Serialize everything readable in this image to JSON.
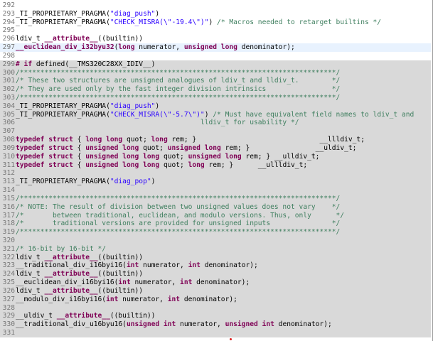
{
  "editor": {
    "lines": [
      {
        "num": "292",
        "tokens": []
      },
      {
        "num": "293",
        "tokens": [
          {
            "t": "_TI_PROPRIETARY_PRAGMA("
          },
          {
            "t": "\"diag_push\"",
            "c": "st"
          },
          {
            "t": ")"
          }
        ]
      },
      {
        "num": "294",
        "tokens": [
          {
            "t": "_TI_PROPRIETARY_PRAGMA("
          },
          {
            "t": "\"CHECK_MISRA(\\\"-19.4\\\")\"",
            "c": "st"
          },
          {
            "t": ") "
          },
          {
            "t": "/* Macros needed to retarget builtins */",
            "c": "cm"
          }
        ]
      },
      {
        "num": "295",
        "tokens": []
      },
      {
        "num": "296",
        "tokens": [
          {
            "t": "ldiv_t "
          },
          {
            "t": "__attribute__",
            "c": "kw"
          },
          {
            "t": "((builtin))"
          }
        ]
      },
      {
        "num": "297",
        "cursor": true,
        "tokens": [
          {
            "t": "__euclidean_div_i32byu32",
            "c": "kw"
          },
          {
            "t": "("
          },
          {
            "t": "long",
            "c": "kw"
          },
          {
            "t": " numerator, "
          },
          {
            "t": "unsigned long",
            "c": "kw"
          },
          {
            "t": " denominator);"
          }
        ]
      },
      {
        "num": "298",
        "tokens": []
      },
      {
        "num": "299",
        "shaded": true,
        "tokens": [
          {
            "t": "# if ",
            "c": "pp"
          },
          {
            "t": "defined(__TMS320C28XX_IDIV__)"
          }
        ]
      },
      {
        "num": "300",
        "shaded": true,
        "tokens": [
          {
            "t": "/*****************************************************************************/",
            "c": "cm"
          }
        ]
      },
      {
        "num": "301",
        "shaded": true,
        "tokens": [
          {
            "t": "/* These two structures are unsigned analogues of ldiv_t and lldiv_t.        */",
            "c": "cm"
          }
        ]
      },
      {
        "num": "302",
        "shaded": true,
        "tokens": [
          {
            "t": "/* They are used only by the fast integer division intrinsics                */",
            "c": "cm"
          }
        ]
      },
      {
        "num": "303",
        "shaded": true,
        "tokens": [
          {
            "t": "/*****************************************************************************/",
            "c": "cm"
          }
        ]
      },
      {
        "num": "304",
        "shaded": true,
        "tokens": [
          {
            "t": "_TI_PROPRIETARY_PRAGMA("
          },
          {
            "t": "\"diag_push\"",
            "c": "st"
          },
          {
            "t": ")"
          }
        ]
      },
      {
        "num": "305",
        "shaded": true,
        "tokens": [
          {
            "t": "_TI_PROPRIETARY_PRAGMA("
          },
          {
            "t": "\"CHECK_MISRA(\\\"-5.7\\\")\"",
            "c": "st"
          },
          {
            "t": ") "
          },
          {
            "t": "/* Must have equivalent field names to ldiv_t and",
            "c": "cm"
          }
        ]
      },
      {
        "num": "306",
        "shaded": true,
        "tokens": [
          {
            "t": "                                             lldiv_t for usability */",
            "c": "cm"
          }
        ]
      },
      {
        "num": "307",
        "shaded": true,
        "tokens": []
      },
      {
        "num": "308",
        "shaded": true,
        "tokens": [
          {
            "t": "typedef struct",
            "c": "kw"
          },
          {
            "t": " { "
          },
          {
            "t": "long long",
            "c": "kw"
          },
          {
            "t": " quot; "
          },
          {
            "t": "long",
            "c": "kw"
          },
          {
            "t": " rem; }                              __llldiv_t;"
          }
        ]
      },
      {
        "num": "309",
        "shaded": true,
        "tokens": [
          {
            "t": "typedef struct",
            "c": "kw"
          },
          {
            "t": " { "
          },
          {
            "t": "unsigned long",
            "c": "kw"
          },
          {
            "t": " quot; "
          },
          {
            "t": "unsigned long",
            "c": "kw"
          },
          {
            "t": " rem; }                __uldiv_t;"
          }
        ]
      },
      {
        "num": "310",
        "shaded": true,
        "tokens": [
          {
            "t": "typedef struct",
            "c": "kw"
          },
          {
            "t": " { "
          },
          {
            "t": "unsigned long long",
            "c": "kw"
          },
          {
            "t": " quot; "
          },
          {
            "t": "unsigned long",
            "c": "kw"
          },
          {
            "t": " rem; } __ulldiv_t;"
          }
        ]
      },
      {
        "num": "311",
        "shaded": true,
        "tokens": [
          {
            "t": "typedef struct",
            "c": "kw"
          },
          {
            "t": " { "
          },
          {
            "t": "unsigned long long",
            "c": "kw"
          },
          {
            "t": " quot; "
          },
          {
            "t": "long",
            "c": "kw"
          },
          {
            "t": " rem; }      __ullldiv_t;"
          }
        ]
      },
      {
        "num": "312",
        "shaded": true,
        "tokens": []
      },
      {
        "num": "313",
        "shaded": true,
        "tokens": [
          {
            "t": "_TI_PROPRIETARY_PRAGMA("
          },
          {
            "t": "\"diag_pop\"",
            "c": "st"
          },
          {
            "t": ")"
          }
        ]
      },
      {
        "num": "314",
        "shaded": true,
        "tokens": []
      },
      {
        "num": "315",
        "shaded": true,
        "tokens": [
          {
            "t": "/*****************************************************************************/",
            "c": "cm"
          }
        ]
      },
      {
        "num": "316",
        "shaded": true,
        "tokens": [
          {
            "t": "/* NOTE: The result of division between two unsigned values does not vary    */",
            "c": "cm"
          }
        ]
      },
      {
        "num": "317",
        "shaded": true,
        "tokens": [
          {
            "t": "/*       between traditional, euclidean, and modulo versions. Thus, only      */",
            "c": "cm"
          }
        ]
      },
      {
        "num": "318",
        "shaded": true,
        "tokens": [
          {
            "t": "/*       traditional versions are provided for unsigned inputs               */",
            "c": "cm"
          }
        ]
      },
      {
        "num": "319",
        "shaded": true,
        "tokens": [
          {
            "t": "/*****************************************************************************/",
            "c": "cm"
          }
        ]
      },
      {
        "num": "320",
        "shaded": true,
        "tokens": []
      },
      {
        "num": "321",
        "shaded": true,
        "tokens": [
          {
            "t": "/* 16-bit by 16-bit */",
            "c": "cm"
          }
        ]
      },
      {
        "num": "322",
        "shaded": true,
        "tokens": [
          {
            "t": "ldiv_t "
          },
          {
            "t": "__attribute__",
            "c": "kw"
          },
          {
            "t": "((builtin))"
          }
        ]
      },
      {
        "num": "323",
        "shaded": true,
        "tokens": [
          {
            "t": "__traditional_div_i16byi16("
          },
          {
            "t": "int",
            "c": "kw"
          },
          {
            "t": " numerator, "
          },
          {
            "t": "int",
            "c": "kw"
          },
          {
            "t": " denominator);"
          }
        ]
      },
      {
        "num": "324",
        "shaded": true,
        "tokens": [
          {
            "t": "ldiv_t "
          },
          {
            "t": "__attribute__",
            "c": "kw"
          },
          {
            "t": "((builtin))"
          }
        ]
      },
      {
        "num": "325",
        "shaded": true,
        "tokens": [
          {
            "t": "__euclidean_div_i16byi16("
          },
          {
            "t": "int",
            "c": "kw"
          },
          {
            "t": " numerator, "
          },
          {
            "t": "int",
            "c": "kw"
          },
          {
            "t": " denominator);"
          }
        ]
      },
      {
        "num": "326",
        "shaded": true,
        "tokens": [
          {
            "t": "ldiv_t "
          },
          {
            "t": "__attribute__",
            "c": "kw"
          },
          {
            "t": "((builtin))"
          }
        ]
      },
      {
        "num": "327",
        "shaded": true,
        "tokens": [
          {
            "t": "__modulo_div_i16byi16("
          },
          {
            "t": "int",
            "c": "kw"
          },
          {
            "t": " numerator, "
          },
          {
            "t": "int",
            "c": "kw"
          },
          {
            "t": " denominator);"
          }
        ]
      },
      {
        "num": "328",
        "shaded": true,
        "tokens": []
      },
      {
        "num": "329",
        "shaded": true,
        "tokens": [
          {
            "t": "__uldiv_t "
          },
          {
            "t": "__attribute__",
            "c": "kw"
          },
          {
            "t": "((builtin))"
          }
        ]
      },
      {
        "num": "330",
        "shaded": true,
        "tokens": [
          {
            "t": "__traditional_div_u16byu16("
          },
          {
            "t": "unsigned int",
            "c": "kw"
          },
          {
            "t": " numerator, "
          },
          {
            "t": "unsigned int",
            "c": "kw"
          },
          {
            "t": " denominator);"
          }
        ]
      },
      {
        "num": "331",
        "shaded": true,
        "tokens": []
      }
    ]
  }
}
